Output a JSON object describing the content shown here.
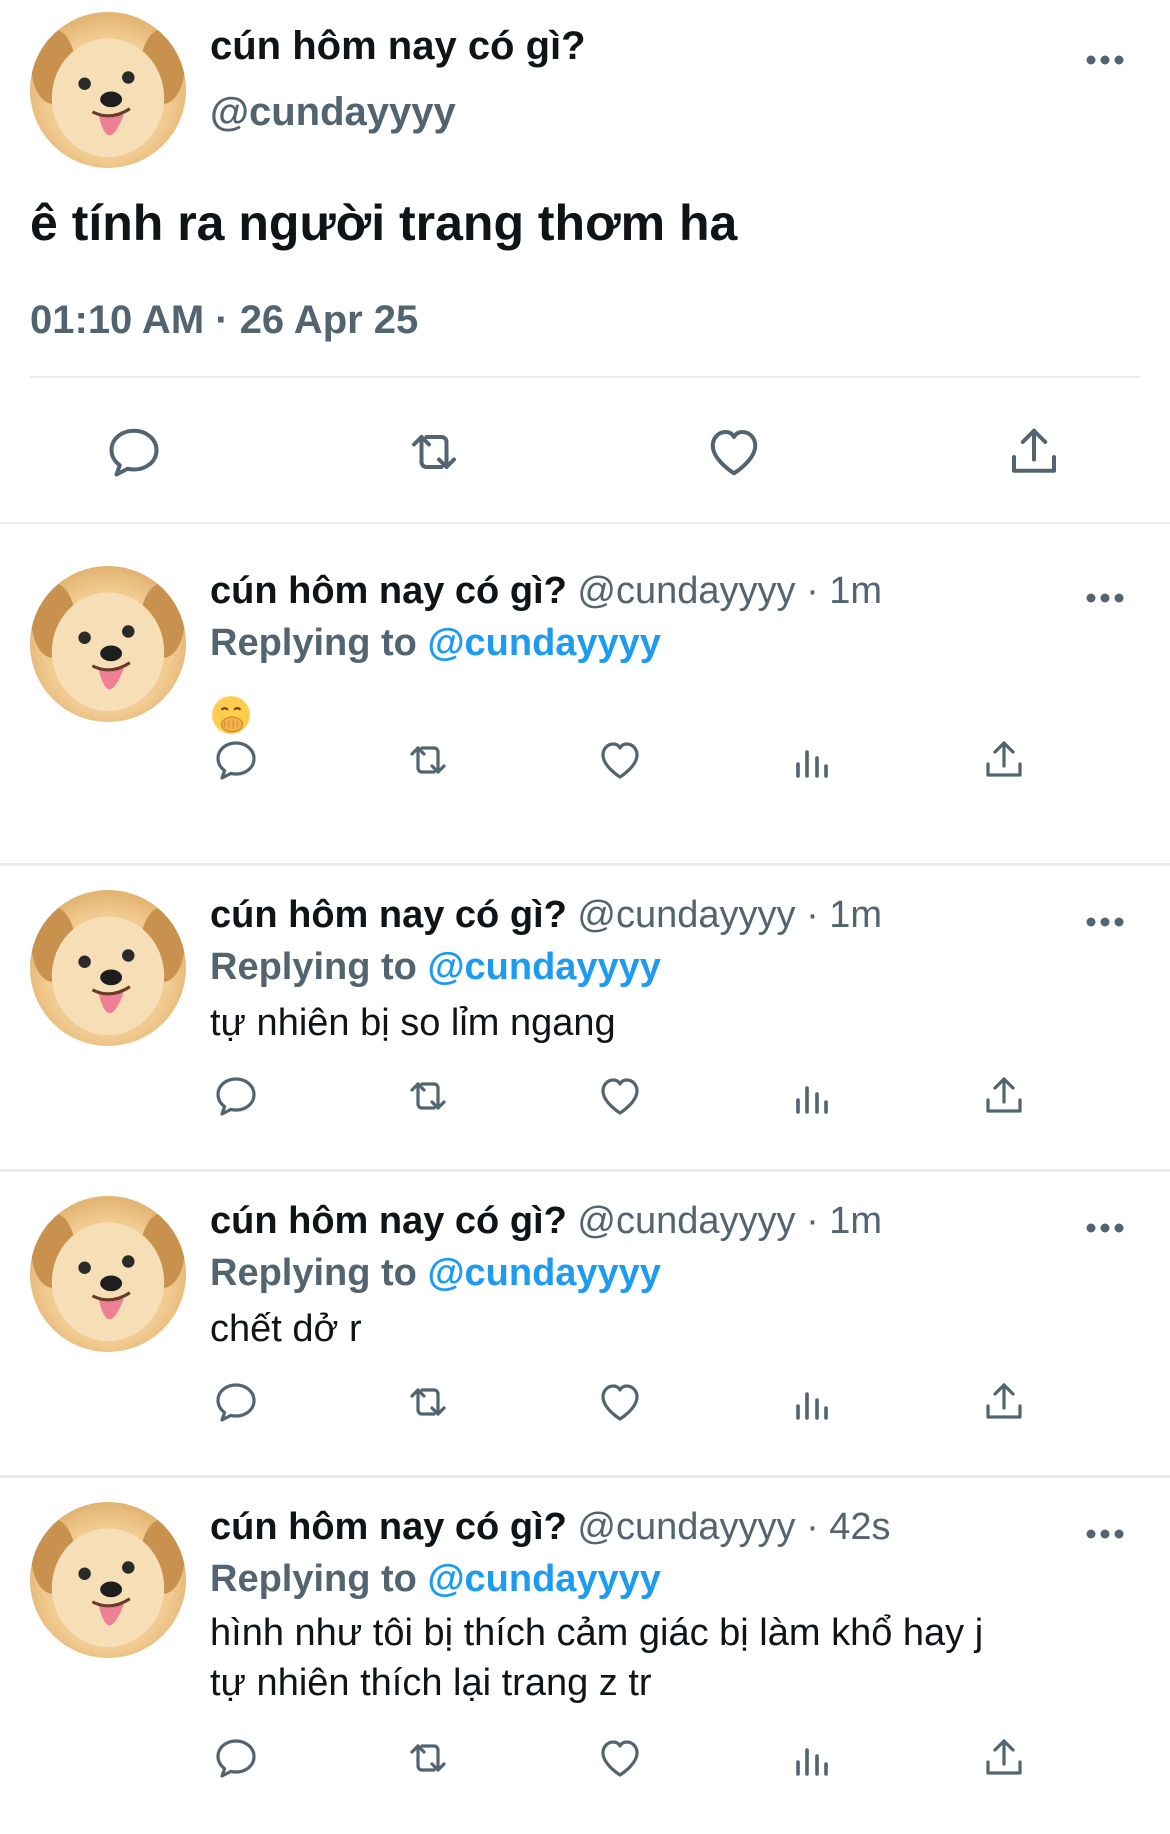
{
  "main_tweet": {
    "display_name": "cún hôm nay có gì?",
    "handle": "@cundayyyy",
    "text": "ê tính ra người trang thơm ha",
    "timestamp": "01:10 AM · 26 Apr 25",
    "actions": [
      "reply-icon",
      "retweet-icon",
      "like-icon",
      "share-icon"
    ]
  },
  "replies": [
    {
      "display_name": "cún hôm nay có gì?",
      "handle": "@cundayyyy",
      "time": "· 1m",
      "replying_label": "Replying to",
      "replying_to": "@cundayyyy",
      "text": "",
      "emoji": "face-with-hand-over-mouth-emoji"
    },
    {
      "display_name": "cún hôm nay có gì?",
      "handle": "@cundayyyy",
      "time": "· 1m",
      "replying_label": "Replying to",
      "replying_to": "@cundayyyy",
      "text": "tự nhiên bị so lỉm ngang"
    },
    {
      "display_name": "cún hôm nay có gì?",
      "handle": "@cundayyyy",
      "time": "· 1m",
      "replying_label": "Replying to",
      "replying_to": "@cundayyyy",
      "text": "chết dở r"
    },
    {
      "display_name": "cún hôm nay có gì?",
      "handle": "@cundayyyy",
      "time": "· 42s",
      "replying_label": "Replying to",
      "replying_to": "@cundayyyy",
      "text_lines": [
        "hình như tôi bị thích cảm giác bị làm khổ hay j",
        "tự nhiên thích lại trang z tr"
      ]
    }
  ],
  "reply_actions": [
    "reply-icon",
    "retweet-icon",
    "like-icon",
    "views-icon",
    "share-icon"
  ],
  "colors": {
    "accent": "#1d9bf0",
    "secondary_text": "#536471",
    "divider": "#e6ecf0"
  }
}
